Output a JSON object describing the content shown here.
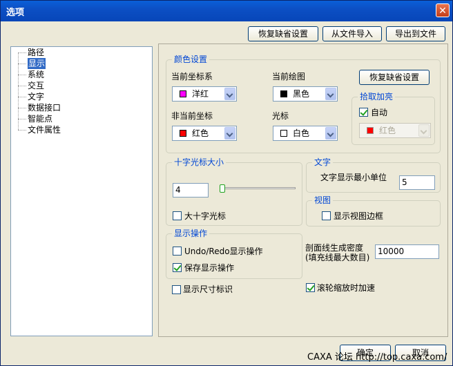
{
  "window": {
    "title": "选项",
    "close_glyph": "✕"
  },
  "toolbar": {
    "restore_defaults": "恢复缺省设置",
    "import_file": "从文件导入",
    "export_file": "导出到文件"
  },
  "tree": {
    "items": [
      {
        "label": "路径",
        "selected": false
      },
      {
        "label": "显示",
        "selected": true
      },
      {
        "label": "系统",
        "selected": false
      },
      {
        "label": "交互",
        "selected": false
      },
      {
        "label": "文字",
        "selected": false
      },
      {
        "label": "数据接口",
        "selected": false
      },
      {
        "label": "智能点",
        "selected": false
      },
      {
        "label": "文件属性",
        "selected": false
      }
    ]
  },
  "color_settings": {
    "title": "颜色设置",
    "current_coord_label": "当前坐标系",
    "current_coord": {
      "text": "洋红",
      "color": "#ff00ff"
    },
    "current_drawing_label": "当前绘图",
    "current_drawing": {
      "text": "黑色",
      "color": "#000000"
    },
    "restore_defaults": "恢复缺省设置",
    "noncurrent_coord_label": "非当前坐标",
    "noncurrent_coord": {
      "text": "红色",
      "color": "#ff0000"
    },
    "cursor_label": "光标",
    "cursor": {
      "text": "白色",
      "color": "#ffffff"
    },
    "pick_highlight": {
      "title": "拾取加亮",
      "auto_label": "自动",
      "auto_checked": true,
      "color": {
        "text": "红色",
        "color": "#ff0000"
      }
    }
  },
  "crosshair": {
    "title": "十字光标大小",
    "size_value": "4",
    "slider_fraction": 0.0,
    "big_crosshair_label": "大十字光标",
    "big_crosshair_checked": false
  },
  "text_group": {
    "title": "文字",
    "min_unit_label": "文字显示最小单位",
    "min_unit_value": "5"
  },
  "view_group": {
    "title": "视图",
    "show_border_label": "显示视图边框",
    "show_border_checked": false
  },
  "display_ops": {
    "title": "显示操作",
    "undo_redo_label": "Undo/Redo显示操作",
    "undo_redo_checked": false,
    "save_ops_label": "保存显示操作",
    "save_ops_checked": true
  },
  "hatch": {
    "label_line1": "剖面线生成密度",
    "label_line2": "(填充线最大数目)",
    "value": "10000"
  },
  "show_dimension": {
    "label": "显示尺寸标识",
    "checked": false
  },
  "wheel_zoom": {
    "label": "滚轮缩放时加速",
    "checked": true
  },
  "buttons": {
    "ok": "确定",
    "cancel": "取消"
  },
  "watermark": "CAXA 论坛 http://top.caxa.com/"
}
